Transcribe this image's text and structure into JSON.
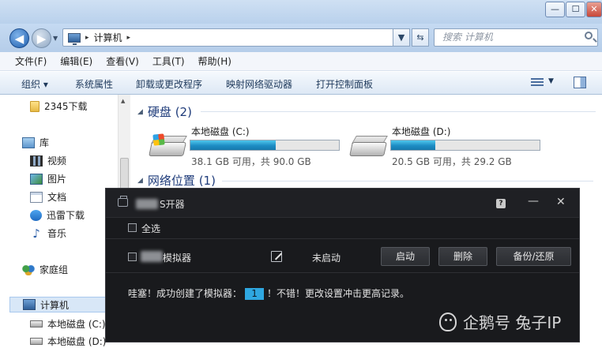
{
  "window": {
    "min_label": "—",
    "max_label": "☐",
    "close_label": "✕"
  },
  "address": {
    "breadcrumb_sep": "▸",
    "breadcrumb": "计算机",
    "breadcrumb_tail": "▸",
    "search_placeholder": "搜索 计算机"
  },
  "menubar": {
    "items": [
      {
        "label": "文件(F)"
      },
      {
        "label": "编辑(E)"
      },
      {
        "label": "查看(V)"
      },
      {
        "label": "工具(T)"
      },
      {
        "label": "帮助(H)"
      }
    ]
  },
  "cmdbar": {
    "organize": "组织 ▾",
    "system_properties": "系统属性",
    "uninstall": "卸载或更改程序",
    "map_drive": "映射网络驱动器",
    "control_panel": "打开控制面板",
    "view_drop": "▼"
  },
  "navpane": {
    "items": [
      {
        "label": "2345下载"
      },
      {
        "label": "库"
      },
      {
        "label": "视频"
      },
      {
        "label": "图片"
      },
      {
        "label": "文档"
      },
      {
        "label": "迅雷下载"
      },
      {
        "label": "音乐"
      },
      {
        "label": "家庭组"
      },
      {
        "label": "计算机"
      },
      {
        "label": "本地磁盘 (C:)"
      },
      {
        "label": "本地磁盘 (D:)"
      }
    ]
  },
  "content": {
    "hard_disks_header": "硬盘 (2)",
    "network_header": "网络位置 (1)",
    "drives": [
      {
        "name": "本地磁盘 (C:)",
        "info": "38.1 GB 可用，共 90.0 GB",
        "used_fraction": 0.577
      },
      {
        "name": "本地磁盘 (D:)",
        "info": "20.5 GB 可用，共 29.2 GB",
        "used_fraction": 0.298
      }
    ]
  },
  "dialog": {
    "title_suffix": "S开器",
    "help": "?",
    "minimize": "—",
    "close": "✕",
    "select_all": "全选",
    "row_name_suffix": "模拟器",
    "row_status": "未启动",
    "btn_start": "启动",
    "btn_delete": "删除",
    "btn_backup": "备份/还原",
    "message_prefix": "哇塞！成功创建了模拟器：",
    "count": "1",
    "message_suffix": "！不错！更改设置冲击更高记录。"
  },
  "watermark": {
    "text": "企鹅号 兔子IP"
  },
  "colors": {
    "accent": "#2fa7e0",
    "dialog_bg": "#191a1d",
    "drive_bar": "#1d8cc4",
    "header_blue": "#1e3b7a"
  }
}
